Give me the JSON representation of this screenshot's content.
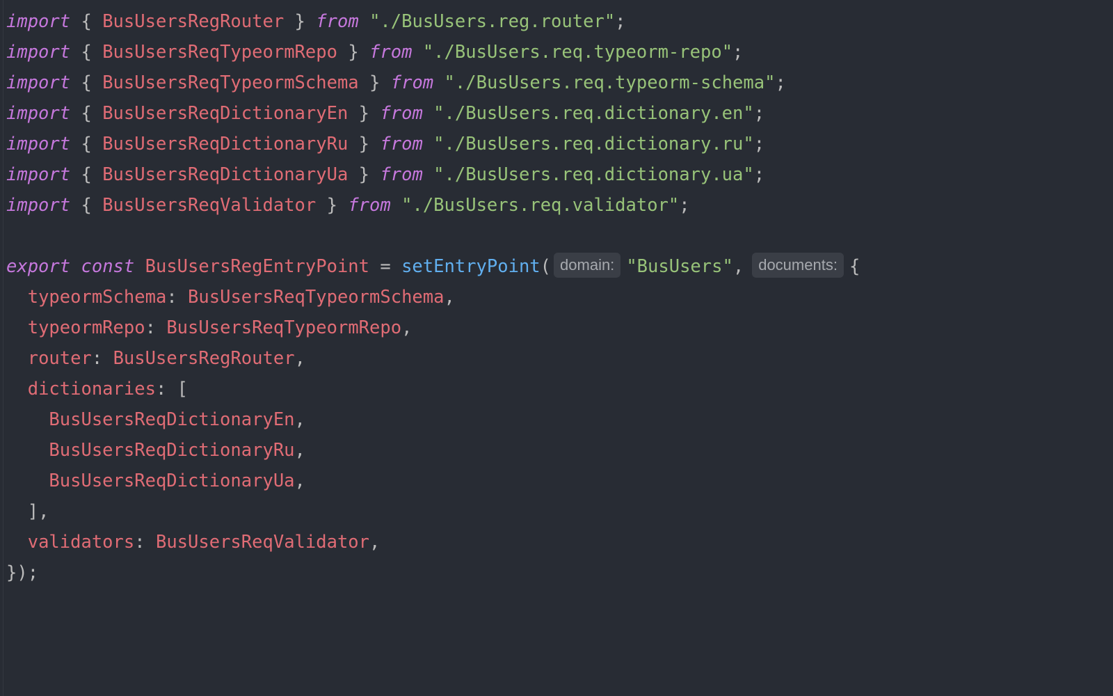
{
  "editor": {
    "imports": [
      {
        "keyword": "import",
        "open": "{ ",
        "name": "BusUsersRegRouter",
        "close": " }",
        "from": "from",
        "path": "\"./BusUsers.reg.router\"",
        "end": ";"
      },
      {
        "keyword": "import",
        "open": "{ ",
        "name": "BusUsersReqTypeormRepo",
        "close": " }",
        "from": "from",
        "path": "\"./BusUsers.req.typeorm-repo\"",
        "end": ";"
      },
      {
        "keyword": "import",
        "open": "{ ",
        "name": "BusUsersReqTypeormSchema",
        "close": " }",
        "from": "from",
        "path": "\"./BusUsers.req.typeorm-schema\"",
        "end": ";"
      },
      {
        "keyword": "import",
        "open": "{ ",
        "name": "BusUsersReqDictionaryEn",
        "close": " }",
        "from": "from",
        "path": "\"./BusUsers.req.dictionary.en\"",
        "end": ";"
      },
      {
        "keyword": "import",
        "open": "{ ",
        "name": "BusUsersReqDictionaryRu",
        "close": " }",
        "from": "from",
        "path": "\"./BusUsers.req.dictionary.ru\"",
        "end": ";"
      },
      {
        "keyword": "import",
        "open": "{ ",
        "name": "BusUsersReqDictionaryUa",
        "close": " }",
        "from": "from",
        "path": "\"./BusUsers.req.dictionary.ua\"",
        "end": ";"
      },
      {
        "keyword": "import",
        "open": "{ ",
        "name": "BusUsersReqValidator",
        "close": " }",
        "from": "from",
        "path": "\"./BusUsers.req.validator\"",
        "end": ";"
      }
    ],
    "export_line": {
      "kw_export": "export",
      "kw_const": "const",
      "name": "BusUsersRegEntryPoint",
      "equals": " = ",
      "fn": "setEntryPoint",
      "paren": "(",
      "hint_domain": "domain:",
      "domain_value": "\"BusUsers\"",
      "comma": ",",
      "hint_documents": "documents:",
      "brace": "{"
    },
    "props": {
      "typeormSchema": {
        "key": "typeormSchema",
        "colon": ": ",
        "value": "BusUsersReqTypeormSchema",
        "comma": ","
      },
      "typeormRepo": {
        "key": "typeormRepo",
        "colon": ": ",
        "value": "BusUsersReqTypeormRepo",
        "comma": ","
      },
      "router": {
        "key": "router",
        "colon": ": ",
        "value": "BusUsersRegRouter",
        "comma": ","
      },
      "dictionaries": {
        "key": "dictionaries",
        "colon": ": ",
        "open": "["
      },
      "dictionary_items": [
        {
          "value": "BusUsersReqDictionaryEn",
          "comma": ","
        },
        {
          "value": "BusUsersReqDictionaryRu",
          "comma": ","
        },
        {
          "value": "BusUsersReqDictionaryUa",
          "comma": ","
        }
      ],
      "dictionaries_close": "],",
      "validators": {
        "key": "validators",
        "colon": ": ",
        "value": "BusUsersReqValidator",
        "comma": ","
      }
    },
    "closing": "});"
  }
}
